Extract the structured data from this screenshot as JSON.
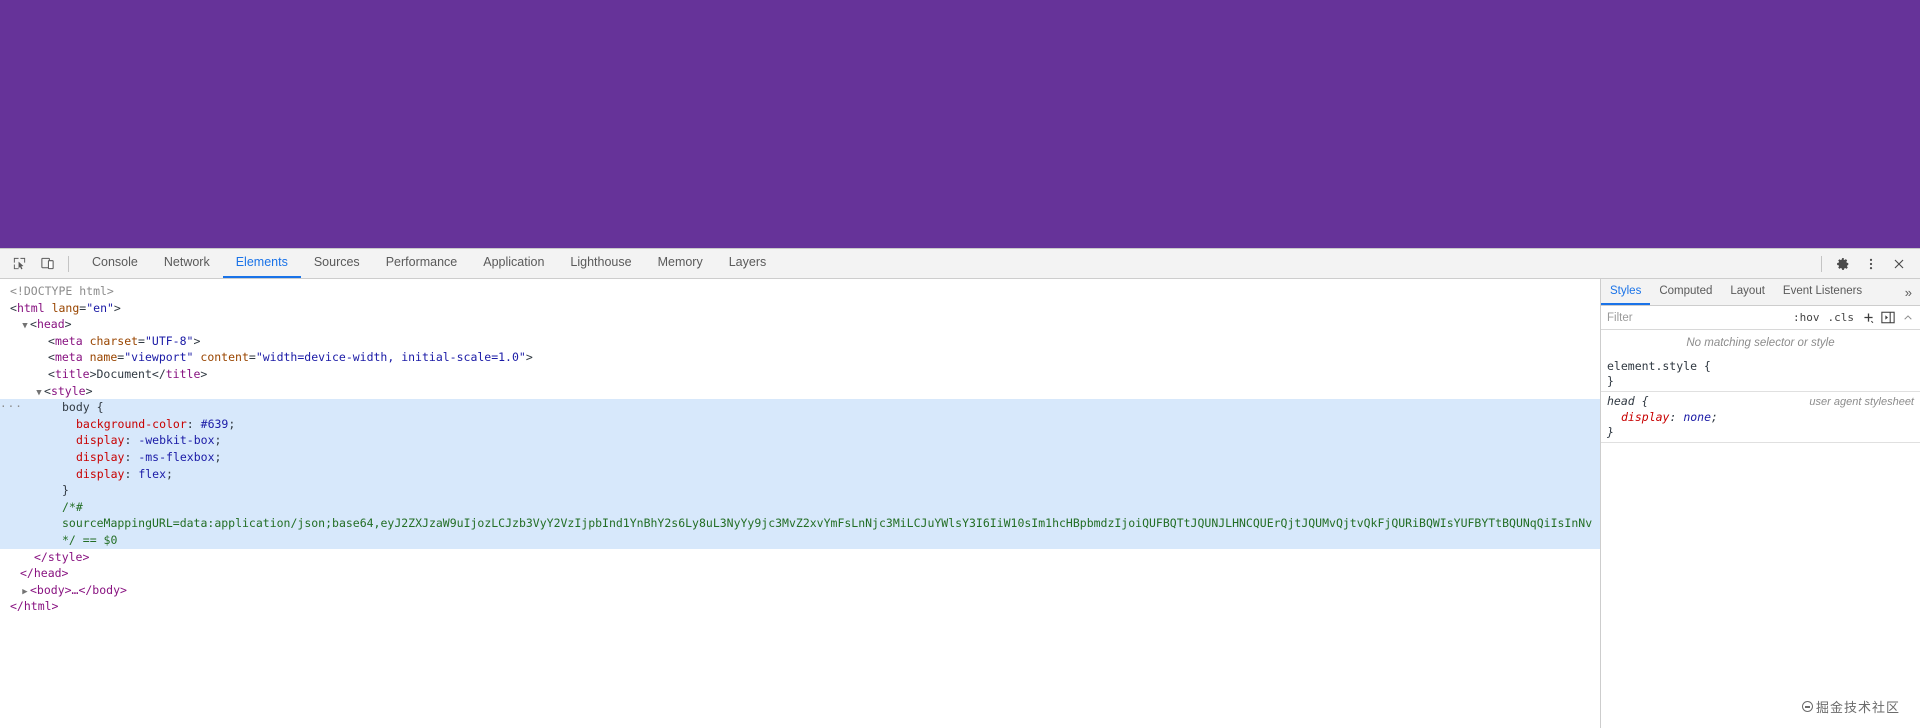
{
  "page": {
    "body_background_color": "#663399"
  },
  "devtools": {
    "toolbar": {
      "inspect_icon": "inspect-element-icon",
      "device_toggle_icon": "device-toolbar-icon",
      "settings_icon": "gear-icon",
      "more_icon": "more-options-icon",
      "close_icon": "close-icon",
      "tabs": [
        {
          "label": "Console",
          "active": false
        },
        {
          "label": "Network",
          "active": false
        },
        {
          "label": "Elements",
          "active": true
        },
        {
          "label": "Sources",
          "active": false
        },
        {
          "label": "Performance",
          "active": false
        },
        {
          "label": "Application",
          "active": false
        },
        {
          "label": "Lighthouse",
          "active": false
        },
        {
          "label": "Memory",
          "active": false
        },
        {
          "label": "Layers",
          "active": false
        }
      ]
    },
    "dom_tree": {
      "doctype": "<!DOCTYPE html>",
      "html_open_tag": "html",
      "html_lang_attr": "lang",
      "html_lang_value": "\"en\"",
      "head_tag": "head",
      "meta_tag": "meta",
      "meta_charset_attr": "charset",
      "meta_charset_value": "\"UTF-8\"",
      "meta_name_attr": "name",
      "meta_name_value": "\"viewport\"",
      "meta_content_attr": "content",
      "meta_content_value": "\"width=device-width, initial-scale=1.0\"",
      "title_tag": "title",
      "title_text": "Document",
      "style_tag": "style",
      "css_selector": "body {",
      "css_decl_1_prop": "background-color",
      "css_decl_1_value": "#639",
      "css_decl_2_prop": "display",
      "css_decl_2_value": "-webkit-box",
      "css_decl_3_prop": "display",
      "css_decl_3_value": "-ms-flexbox",
      "css_decl_4_prop": "display",
      "css_decl_4_value": "flex",
      "css_close_brace": "}",
      "comment_open": "/*#",
      "source_mapping_line": "sourceMappingURL=data:application/json;base64,eyJ2ZXJzaW9uIjozLCJzb3VyY2VzIjpbInd1YnBhY2s6Ly8uL3NyYy9jc3MvZ2xvYmFsLnNjc3MiLCJuYWlsY3I6IiW10sIm1hcHBpbmdzIjoiQUFBQTtJQUNJLHNCQUErQjtJQUMvQjtvQkFjQURiBQWIsYUFBYTtBQUNqQiIsInNv",
      "comment_close": "*/ == $0",
      "ellipsis_marker": "···",
      "body_collapsed": "<body>…</body>",
      "close_style": "</style>",
      "close_head": "</head>",
      "close_html": "</html>"
    },
    "styles_panel": {
      "tabs": [
        {
          "label": "Styles",
          "active": true
        },
        {
          "label": "Computed",
          "active": false
        },
        {
          "label": "Layout",
          "active": false
        },
        {
          "label": "Event Listeners",
          "active": false
        }
      ],
      "more_tabs_glyph": "»",
      "filter": {
        "placeholder": "Filter",
        "value": "",
        "hov_label": ":hov",
        "cls_label": ".cls",
        "new_rule_icon": "plus-icon",
        "class_toggle_icon": "toggle-sidebar-icon",
        "scroll_up_icon": "chevron-up-icon"
      },
      "no_matching_text": "No matching selector or style",
      "rules": [
        {
          "selector": "element.style {",
          "origin": "",
          "declarations": [],
          "close": "}"
        },
        {
          "selector": "head {",
          "origin": "user agent stylesheet",
          "declarations": [
            {
              "property": "display",
              "value": "none",
              "semicolon": ";"
            }
          ],
          "close": "}"
        }
      ]
    }
  },
  "watermark": {
    "text": "掘金技术社区"
  }
}
